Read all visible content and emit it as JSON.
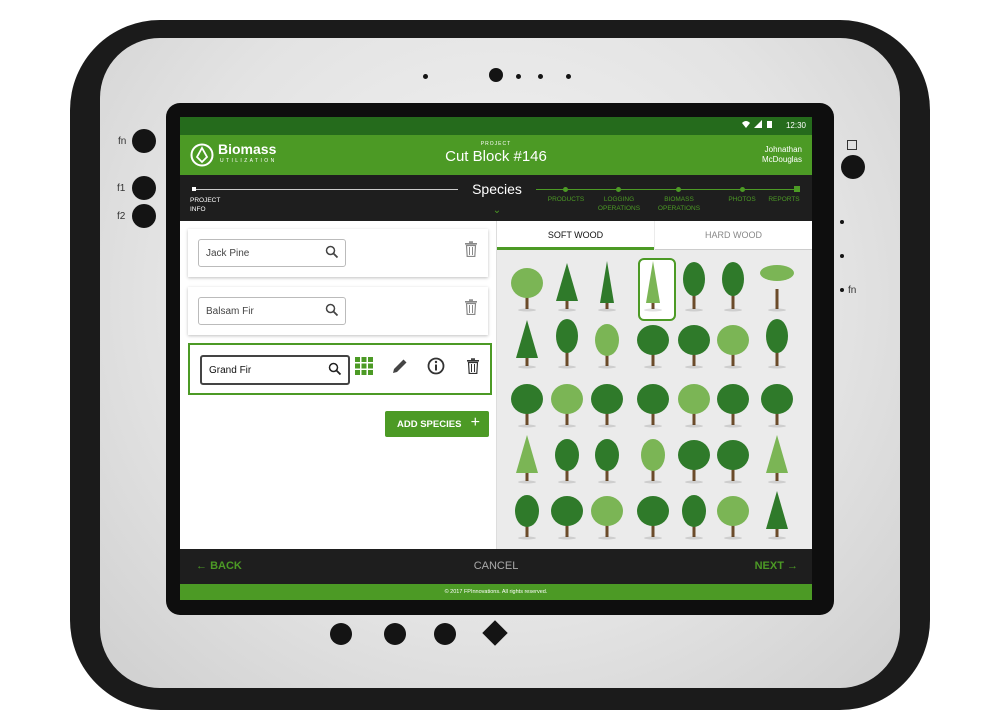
{
  "device": {
    "side_left": [
      "fn",
      "f1",
      "f2"
    ],
    "side_right": [
      "fn"
    ],
    "bottom_icons": [
      "power-icon",
      "volume-down-icon",
      "volume-up-icon",
      "home-diamond-icon"
    ]
  },
  "status_bar": {
    "time": "12:30",
    "icons": [
      "wifi-icon",
      "signal-icon",
      "battery-icon"
    ]
  },
  "header": {
    "brand_name": "Biomass",
    "brand_sub": "UTILIZATION",
    "project_label": "PROJECT",
    "project_title": "Cut Block #146",
    "user_first": "Johnathan",
    "user_last": "McDouglas"
  },
  "steps": {
    "first": "PROJECT\nINFO",
    "current": "Species",
    "items": [
      "PRODUCTS",
      "LOGGING\nOPERATIONS",
      "BIOMASS\nOPERATIONS",
      "PHOTOS",
      "REPORTS"
    ]
  },
  "species": [
    {
      "name": "Jack Pine",
      "selected": false
    },
    {
      "name": "Balsam Fir",
      "selected": false
    },
    {
      "name": "Grand Fir",
      "selected": true
    }
  ],
  "add_species_label": "ADD SPECIES",
  "tabs": {
    "soft": "SOFT WOOD",
    "hard": "HARD WOOD",
    "active": "soft"
  },
  "nav": {
    "back": "BACK",
    "cancel": "CANCEL",
    "next": "NEXT"
  },
  "footer": "© 2017 FPInnovations. All rights reserved.",
  "colors": {
    "accent": "#4c9a25",
    "dark_accent": "#256b1c",
    "bar": "#1e1e1e",
    "tree_dark": "#2f7a2a",
    "tree_light": "#7bb555"
  }
}
